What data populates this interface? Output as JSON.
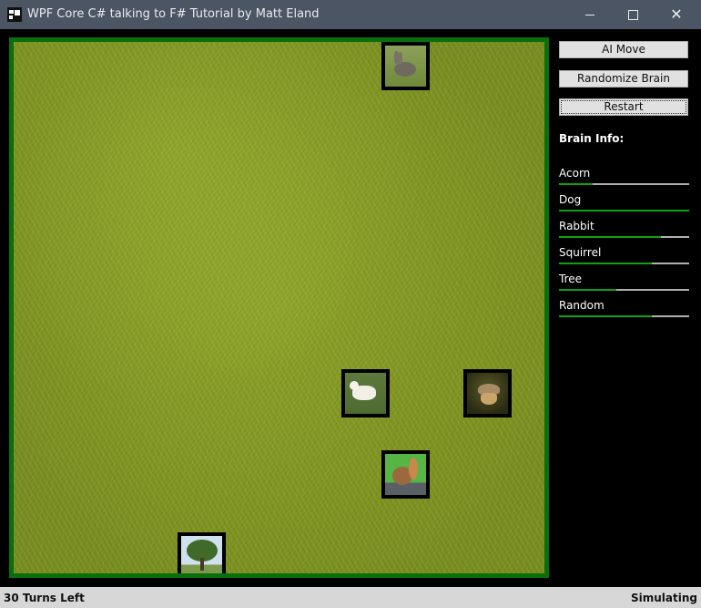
{
  "window": {
    "title": "WPF Core C# talking to F# Tutorial by Matt Eland",
    "icon": "app-window-icon",
    "controls": [
      "minimize-icon",
      "maximize-icon",
      "close-icon"
    ],
    "close_glyph": "✕"
  },
  "board": {
    "grid_size": 13,
    "border_color": "#0a6e0a",
    "background": "grass",
    "actors": [
      {
        "name": "Rabbit",
        "col": 9,
        "row": 0,
        "icon": "rabbit-icon"
      },
      {
        "name": "Dog",
        "col": 8,
        "row": 8,
        "icon": "dog-icon"
      },
      {
        "name": "Acorn",
        "col": 11,
        "row": 8,
        "icon": "acorn-icon"
      },
      {
        "name": "Squirrel",
        "col": 9,
        "row": 10,
        "icon": "squirrel-icon"
      },
      {
        "name": "Tree",
        "col": 4,
        "row": 12,
        "icon": "tree-icon"
      }
    ]
  },
  "sidebar": {
    "buttons": {
      "ai_move": "AI Move",
      "randomize_brain": "Randomize Brain",
      "restart": "Restart"
    },
    "brain_title": "Brain Info:",
    "brain": [
      {
        "label": "Acorn",
        "value": 0.26
      },
      {
        "label": "Dog",
        "value": 1.0
      },
      {
        "label": "Rabbit",
        "value": 0.78
      },
      {
        "label": "Squirrel",
        "value": 0.71
      },
      {
        "label": "Tree",
        "value": 0.44
      },
      {
        "label": "Random",
        "value": 0.71
      }
    ],
    "bar_fill_color": "#12a012",
    "bar_track_color": "#b0b0b0"
  },
  "status": {
    "turns_left": "30 Turns Left",
    "state": "Simulating"
  }
}
